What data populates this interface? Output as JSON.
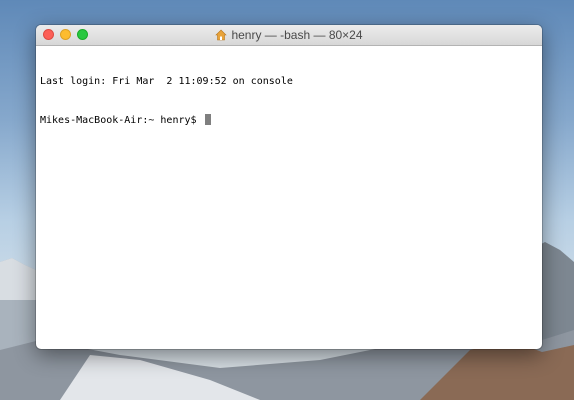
{
  "window": {
    "title": "henry — -bash — 80×24",
    "title_icon": "home-folder-icon"
  },
  "terminal": {
    "lines": [
      "Last login: Fri Mar  2 11:09:52 on console"
    ],
    "prompt": "Mikes-MacBook-Air:~ henry$ "
  },
  "colors": {
    "close": "#fc5f57",
    "minimize": "#fdbc2e",
    "maximize": "#29c840"
  }
}
